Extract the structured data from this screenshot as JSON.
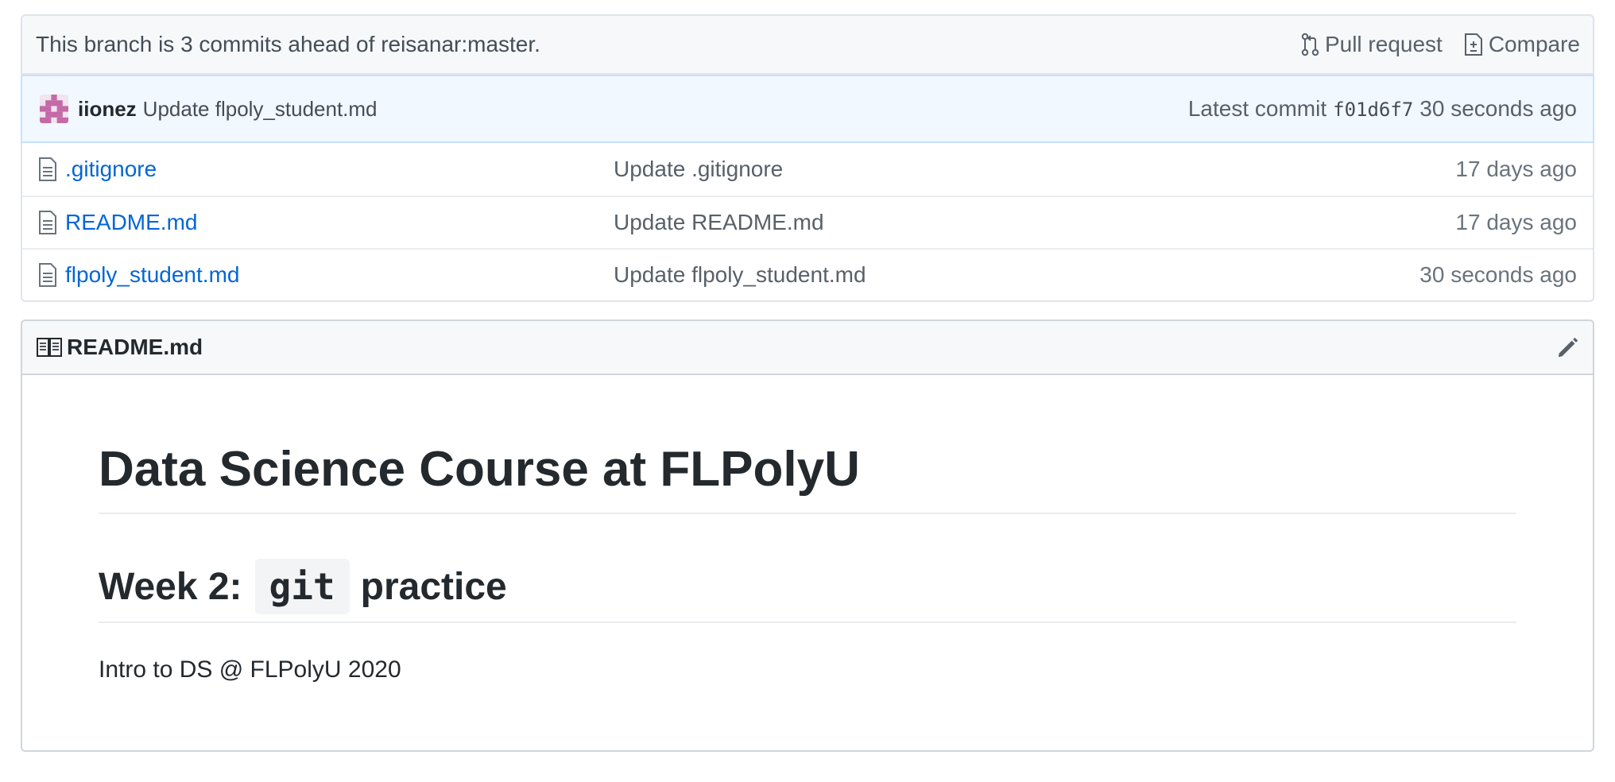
{
  "branch_bar": {
    "text": "This branch is 3 commits ahead of reisanar:master.",
    "pull_request_label": "Pull request",
    "compare_label": "Compare"
  },
  "commit": {
    "author": "iionez",
    "message": "Update flpoly_student.md",
    "latest_label": "Latest commit",
    "sha": "f01d6f7",
    "age": "30 seconds ago",
    "avatar_color": "#c46aa7"
  },
  "files": [
    {
      "name": ".gitignore",
      "message": "Update .gitignore",
      "age": "17 days ago"
    },
    {
      "name": "README.md",
      "message": "Update README.md",
      "age": "17 days ago"
    },
    {
      "name": "flpoly_student.md",
      "message": "Update flpoly_student.md",
      "age": "30 seconds ago"
    }
  ],
  "readme": {
    "filename": "README.md",
    "h1": "Data Science Course at FLPolyU",
    "h2_prefix": "Week 2:",
    "h2_code": "git",
    "h2_suffix": "practice",
    "paragraph": "Intro to DS @ FLPolyU 2020"
  },
  "icons": {
    "pull_request": "git-pull-request-icon",
    "compare": "diff-icon",
    "file": "file-icon",
    "readme": "book-icon",
    "edit": "pencil-icon"
  },
  "colors": {
    "link": "#0366d6",
    "commit_bg": "#f1f8ff",
    "header_bg": "#f6f8fa"
  }
}
